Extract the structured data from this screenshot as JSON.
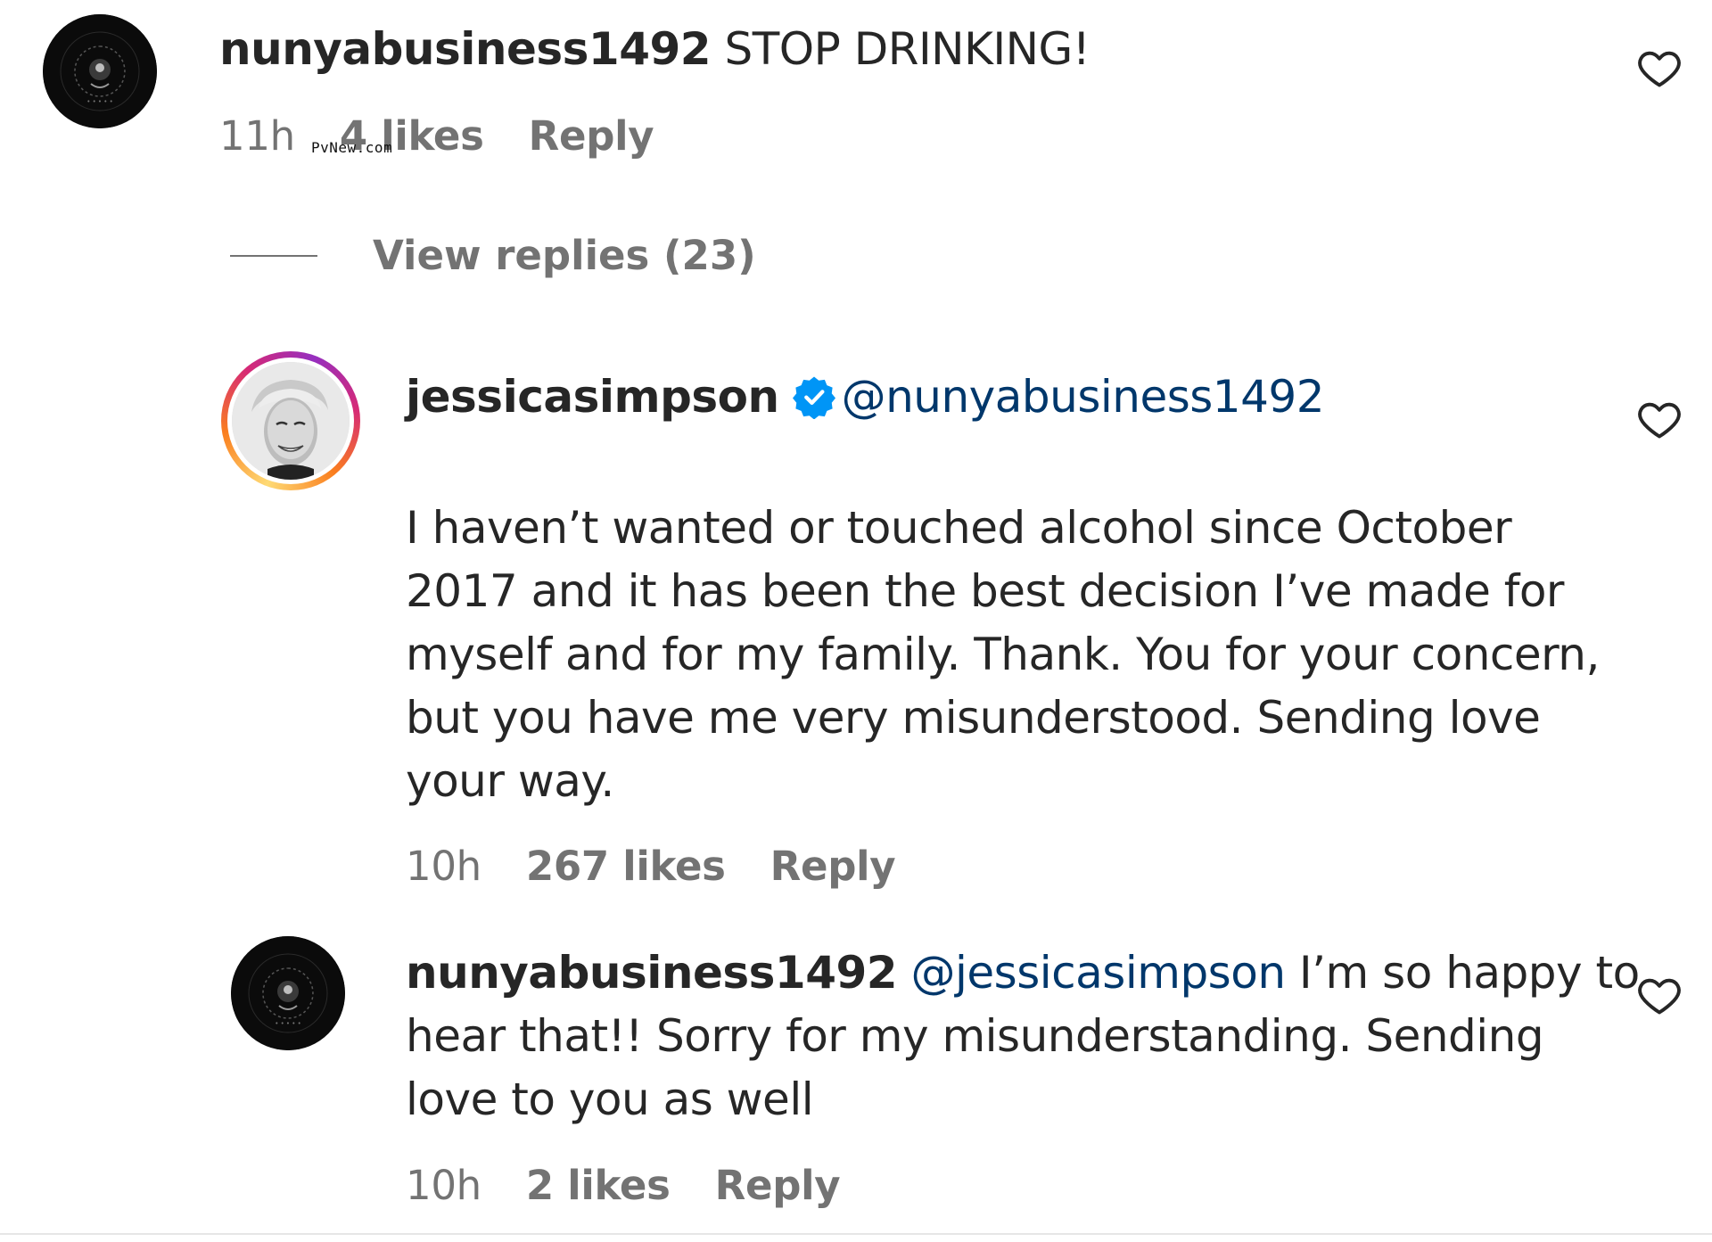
{
  "comment1": {
    "username": "nunyabusiness1492",
    "text": "STOP DRINKING!",
    "time": "11h",
    "likes": "4 likes",
    "reply": "Reply"
  },
  "watermark": "PvNew.com",
  "view_replies": "View replies (23)",
  "reply1": {
    "username": "jessicasimpson",
    "mention": "@nunyabusiness1492",
    "lines": [
      "I haven’t wanted or touched alcohol since October",
      "2017 and it has been the best decision I’ve made for",
      "myself and for my family. Thank. You for your concern,",
      "but you have me very misunderstood. Sending love",
      "your way."
    ],
    "time": "10h",
    "likes": "267 likes",
    "reply": "Reply"
  },
  "reply2": {
    "username": "nunyabusiness1492",
    "mention": "@jessicasimpson",
    "line1_rest": "I’m so happy to",
    "line2": "hear that!! Sorry for my misunderstanding. Sending",
    "line3": "love to you as well",
    "time": "10h",
    "likes": "2 likes",
    "reply": "Reply"
  },
  "colors": {
    "text": "#262626",
    "muted": "#737373",
    "mention": "#00376b",
    "verified": "#0095f6"
  },
  "icons": {
    "heart": "heart-outline-icon",
    "verified": "verified-badge-icon",
    "avatar": "black-circle-logo"
  }
}
